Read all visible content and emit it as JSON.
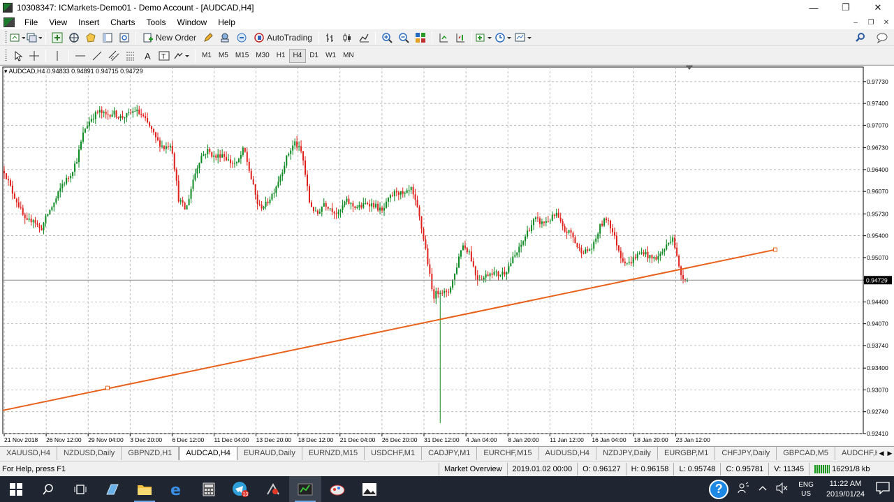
{
  "window": {
    "title": "10308347: ICMarkets-Demo01 - Demo Account - [AUDCAD,H4]",
    "minimize": "—",
    "restore": "❐",
    "close": "✕"
  },
  "menu": {
    "items": [
      "File",
      "View",
      "Insert",
      "Charts",
      "Tools",
      "Window",
      "Help"
    ],
    "mdi_min": "–",
    "mdi_restore": "❐",
    "mdi_close": "✕"
  },
  "toolbar": {
    "new_order": "New Order",
    "auto_trading": "AutoTrading"
  },
  "timeframes": [
    "M1",
    "M5",
    "M15",
    "M30",
    "H1",
    "H4",
    "D1",
    "W1",
    "MN"
  ],
  "active_timeframe": "H4",
  "chart": {
    "header": "AUDCAD,H4  0.94833 0.94891 0.94715 0.94729",
    "current_price_label": "0.94729",
    "colors": {
      "bull": "#0a8a20",
      "bear": "#e0201a",
      "trendline": "#e8601a",
      "grid": "#a0a0a0",
      "bid_line": "#8a8a8a"
    }
  },
  "chart_data": {
    "type": "candlestick",
    "symbol": "AUDCAD",
    "timeframe": "H4",
    "ohlc": {
      "open": 0.94833,
      "high": 0.94891,
      "low": 0.94715,
      "close": 0.94729
    },
    "ylim": [
      0.9241,
      0.9795
    ],
    "y_ticks": [
      "0.97730",
      "0.97400",
      "0.97070",
      "0.96730",
      "0.96400",
      "0.96070",
      "0.95730",
      "0.95400",
      "0.95070",
      "0.94729",
      "0.94400",
      "0.94070",
      "0.93740",
      "0.93400",
      "0.93070",
      "0.92740",
      "0.92410"
    ],
    "x_ticks": [
      "21 Nov 2018",
      "26 Nov 12:00",
      "29 Nov 04:00",
      "3 Dec 20:00",
      "6 Dec 12:00",
      "11 Dec 04:00",
      "13 Dec 20:00",
      "18 Dec 12:00",
      "21 Dec 04:00",
      "26 Dec 20:00",
      "31 Dec 12:00",
      "4 Jan 04:00",
      "8 Jan 20:00",
      "11 Jan 12:00",
      "16 Jan 04:00",
      "18 Jan 20:00",
      "23 Jan 12:00"
    ],
    "close_path": [
      0.9638,
      0.9609,
      0.9586,
      0.9559,
      0.9566,
      0.9548,
      0.9573,
      0.9592,
      0.9618,
      0.963,
      0.9655,
      0.97,
      0.9718,
      0.9728,
      0.9722,
      0.9726,
      0.9719,
      0.9722,
      0.973,
      0.9721,
      0.9705,
      0.9684,
      0.9673,
      0.968,
      0.9596,
      0.9578,
      0.9625,
      0.9659,
      0.9669,
      0.9658,
      0.9664,
      0.9652,
      0.9648,
      0.9672,
      0.9626,
      0.9583,
      0.9587,
      0.9605,
      0.9631,
      0.9662,
      0.9681,
      0.9664,
      0.9591,
      0.9571,
      0.959,
      0.9581,
      0.9572,
      0.9593,
      0.9585,
      0.9583,
      0.959,
      0.9586,
      0.9576,
      0.9596,
      0.9608,
      0.96,
      0.961,
      0.9575,
      0.952,
      0.9448,
      0.9458,
      0.9451,
      0.9482,
      0.9527,
      0.9516,
      0.9476,
      0.9477,
      0.9486,
      0.9481,
      0.9486,
      0.9505,
      0.9522,
      0.9546,
      0.9565,
      0.9559,
      0.9564,
      0.9572,
      0.9548,
      0.9544,
      0.952,
      0.9516,
      0.9522,
      0.9554,
      0.9568,
      0.9537,
      0.9505,
      0.9498,
      0.951,
      0.9516,
      0.9505,
      0.9508,
      0.9522,
      0.954,
      0.9483,
      0.94729
    ],
    "trendline": [
      {
        "time": "21 Nov 2018",
        "price": 0.9276
      },
      {
        "time": "29 Nov 04:00",
        "price": 0.931
      },
      {
        "price": 0.9519
      }
    ]
  },
  "tabs": [
    "XAUUSD,H4",
    "NZDUSD,Daily",
    "GBPNZD,H1",
    "AUDCAD,H4",
    "EURAUD,Daily",
    "EURNZD,M15",
    "USDCHF,M1",
    "CADJPY,M1",
    "EURCHF,M15",
    "AUDUSD,H4",
    "NZDJPY,Daily",
    "EURGBP,M1",
    "CHFJPY,Daily",
    "GBPCAD,M5",
    "AUDCHF,H"
  ],
  "active_tab": "AUDCAD,H4",
  "status": {
    "help": "For Help, press F1",
    "profile": "Market Overview",
    "datetime": "2019.01.02 00:00",
    "open": "O: 0.96127",
    "high": "H: 0.96158",
    "low": "L: 0.95748",
    "close": "C: 0.95781",
    "volume": "V: 11345",
    "traffic": "16291/8 kb"
  },
  "taskbar": {
    "badge": "13",
    "lang_top": "ENG",
    "lang_bottom": "US",
    "time": "11:22 AM",
    "date": "2019/01/24"
  }
}
